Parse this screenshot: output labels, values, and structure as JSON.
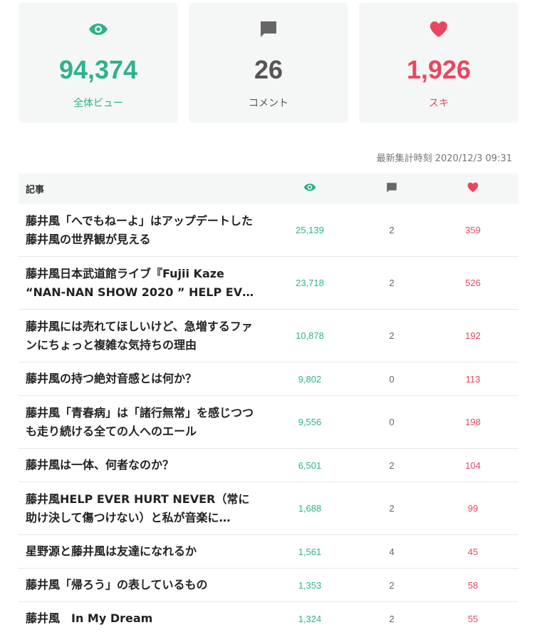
{
  "summary": {
    "views": {
      "icon": "eye-icon",
      "value": "94,374",
      "label": "全体ビュー",
      "color": "#2eb28e"
    },
    "comments": {
      "icon": "comment-icon",
      "value": "26",
      "label": "コメント",
      "color": "#666666"
    },
    "likes": {
      "icon": "heart-icon",
      "value": "1,926",
      "label": "スキ",
      "color": "#e8475f"
    }
  },
  "timestamp": "最新集計時刻 2020/12/3 09:31",
  "table": {
    "header": {
      "title": "記事",
      "views_icon": "eye-icon",
      "comments_icon": "comment-icon",
      "likes_icon": "heart-icon"
    },
    "rows": [
      {
        "title": "藤井風「へでもねーよ」はアップデートした藤井風の世界観が見える",
        "views": "25,139",
        "comments": "2",
        "likes": "359"
      },
      {
        "title": "藤井風日本武道館ライブ『Fujii Kaze “NAN-NAN SHOW 2020 ” HELP EV…",
        "views": "23,718",
        "comments": "2",
        "likes": "526"
      },
      {
        "title": "藤井風には売れてほしいけど、急増するファンにちょっと複雑な気持ちの理由",
        "views": "10,878",
        "comments": "2",
        "likes": "192"
      },
      {
        "title": "藤井風の持つ絶対音感とは何か？",
        "views": "9,802",
        "comments": "0",
        "likes": "113"
      },
      {
        "title": "藤井風「青春病」は「諸行無常」を感じつつも走り続ける全ての人へのエール",
        "views": "9,556",
        "comments": "0",
        "likes": "198"
      },
      {
        "title": "藤井風は一体、何者なのか？",
        "views": "6,501",
        "comments": "2",
        "likes": "104"
      },
      {
        "title": "藤井風HELP EVER HURT NEVER（常に助け決して傷つけない）と私が音楽に…",
        "views": "1,688",
        "comments": "2",
        "likes": "99"
      },
      {
        "title": "星野源と藤井風は友達になれるか",
        "views": "1,561",
        "comments": "4",
        "likes": "45"
      },
      {
        "title": "藤井風「帰ろう」の表しているもの",
        "views": "1,353",
        "comments": "2",
        "likes": "58"
      },
      {
        "title": "藤井風　In My Dream",
        "views": "1,324",
        "comments": "2",
        "likes": "55"
      }
    ]
  }
}
